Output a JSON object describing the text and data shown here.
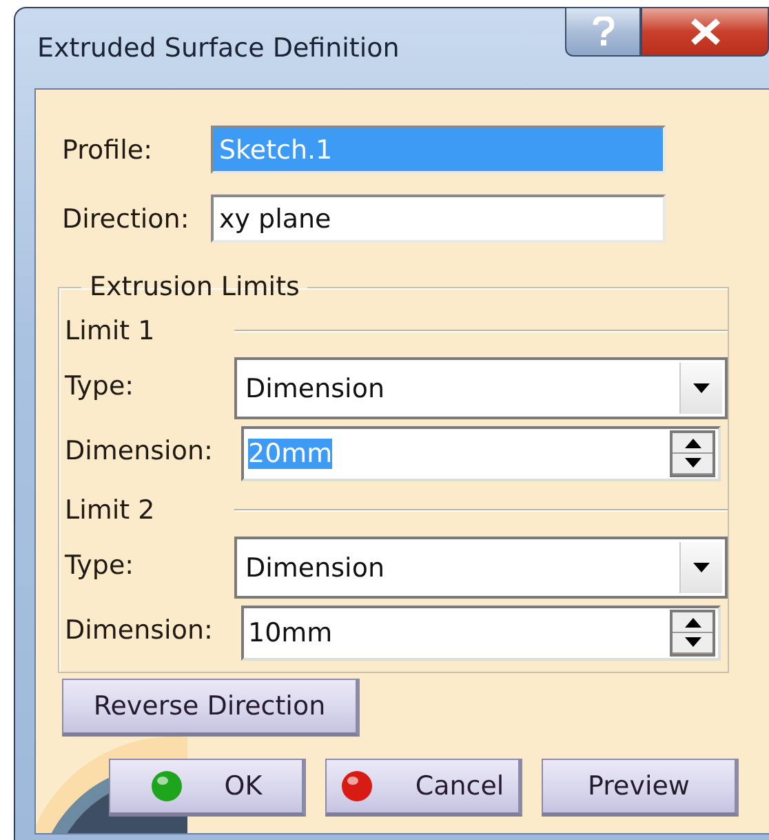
{
  "window": {
    "title": "Extruded Surface Definition"
  },
  "fields": [
    {
      "label": "Profile:",
      "value": "Sketch.1",
      "selected": true
    },
    {
      "label": "Direction:",
      "value": "xy plane",
      "selected": false
    }
  ],
  "extrusion_limits": {
    "legend": "Extrusion Limits",
    "limits": [
      {
        "heading": "Limit 1",
        "type_label": "Type:",
        "type_value": "Dimension",
        "dimension_label": "Dimension:",
        "dimension_value": "20mm",
        "dimension_selected": true
      },
      {
        "heading": "Limit 2",
        "type_label": "Type:",
        "type_value": "Dimension",
        "dimension_label": "Dimension:",
        "dimension_value": "10mm",
        "dimension_selected": false
      }
    ]
  },
  "reverse_button": "Reverse Direction",
  "buttons": [
    {
      "label": "OK",
      "kind": "ok"
    },
    {
      "label": "Cancel",
      "kind": "cancel"
    },
    {
      "label": "Preview",
      "kind": "plain"
    }
  ]
}
